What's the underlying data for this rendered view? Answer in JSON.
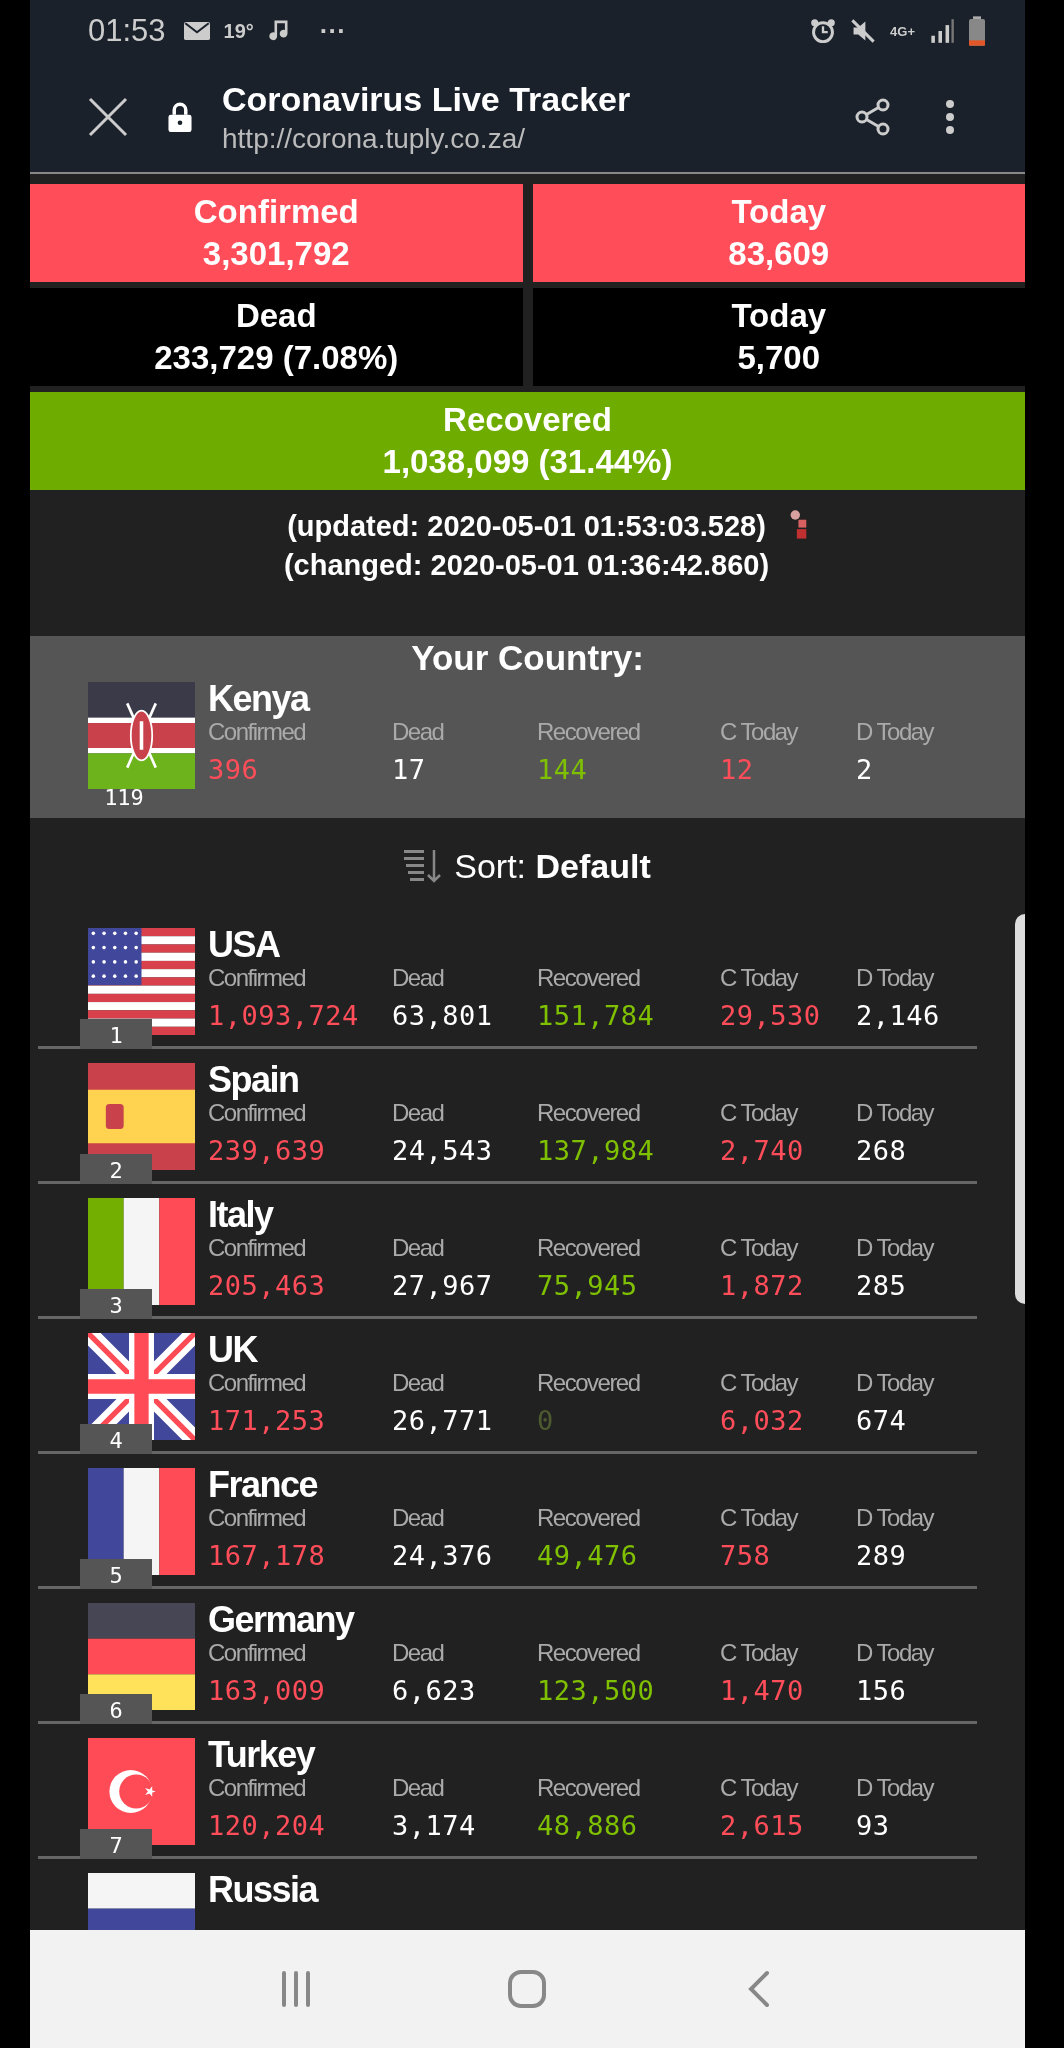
{
  "status_bar": {
    "time": "01:53",
    "temperature": "19°",
    "more": "···",
    "network": "4G+"
  },
  "header": {
    "title": "Coronavirus Live Tracker",
    "url": "http://corona.tuply.co.za/"
  },
  "totals": [
    {
      "label": "Confirmed",
      "value": "3,301,792",
      "kind": "red"
    },
    {
      "label": "Today",
      "value": "83,609",
      "kind": "red"
    },
    {
      "label": "Dead",
      "value": "233,729 (7.08%)",
      "kind": "black"
    },
    {
      "label": "Today",
      "value": "5,700",
      "kind": "black"
    },
    {
      "label": "Recovered",
      "value": "1,038,099 (31.44%)",
      "kind": "green"
    }
  ],
  "updated": "(updated: 2020-05-01 01:53:03.528)",
  "changed": "(changed: 2020-05-01 01:36:42.860)",
  "your_country": {
    "heading": "Your Country:",
    "name": "Kenya",
    "rank": "119",
    "labels": [
      "Confirmed",
      "Dead",
      "Recovered",
      "C Today",
      "D Today"
    ],
    "values": [
      "396",
      "17",
      "144",
      "12",
      "2"
    ]
  },
  "sort": {
    "label": "Sort:",
    "value": "Default"
  },
  "countries": [
    {
      "name": "USA",
      "rank": "1",
      "labels": [
        "Confirmed",
        "Dead",
        "Recovered",
        "C Today",
        "D Today"
      ],
      "values": [
        "1,093,724",
        "63,801",
        "151,784",
        "29,530",
        "2,146"
      ],
      "recovered_dim": false
    },
    {
      "name": "Spain",
      "rank": "2",
      "labels": [
        "Confirmed",
        "Dead",
        "Recovered",
        "C Today",
        "D Today"
      ],
      "values": [
        "239,639",
        "24,543",
        "137,984",
        "2,740",
        "268"
      ],
      "recovered_dim": false
    },
    {
      "name": "Italy",
      "rank": "3",
      "labels": [
        "Confirmed",
        "Dead",
        "Recovered",
        "C Today",
        "D Today"
      ],
      "values": [
        "205,463",
        "27,967",
        "75,945",
        "1,872",
        "285"
      ],
      "recovered_dim": false
    },
    {
      "name": "UK",
      "rank": "4",
      "labels": [
        "Confirmed",
        "Dead",
        "Recovered",
        "C Today",
        "D Today"
      ],
      "values": [
        "171,253",
        "26,771",
        "0",
        "6,032",
        "674"
      ],
      "recovered_dim": true
    },
    {
      "name": "France",
      "rank": "5",
      "labels": [
        "Confirmed",
        "Dead",
        "Recovered",
        "C Today",
        "D Today"
      ],
      "values": [
        "167,178",
        "24,376",
        "49,476",
        "758",
        "289"
      ],
      "recovered_dim": false
    },
    {
      "name": "Germany",
      "rank": "6",
      "labels": [
        "Confirmed",
        "Dead",
        "Recovered",
        "C Today",
        "D Today"
      ],
      "values": [
        "163,009",
        "6,623",
        "123,500",
        "1,470",
        "156"
      ],
      "recovered_dim": false
    },
    {
      "name": "Turkey",
      "rank": "7",
      "labels": [
        "Confirmed",
        "Dead",
        "Recovered",
        "C Today",
        "D Today"
      ],
      "values": [
        "120,204",
        "3,174",
        "48,886",
        "2,615",
        "93"
      ],
      "recovered_dim": false
    },
    {
      "name": "Russia"
    }
  ]
}
